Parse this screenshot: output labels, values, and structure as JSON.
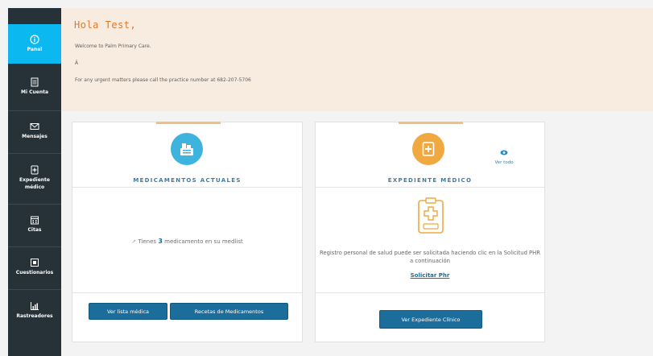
{
  "sidebar": {
    "items": [
      {
        "label": "Panel",
        "icon": "info-circle-icon"
      },
      {
        "label": "Mi Cuenta",
        "icon": "document-icon"
      },
      {
        "label": "Mensajes",
        "icon": "envelope-icon"
      },
      {
        "label": "Expediente médico",
        "icon": "medical-record-icon"
      },
      {
        "label": "Citas",
        "icon": "calendar-icon"
      },
      {
        "label": "Cuestionarios",
        "icon": "questionnaire-icon"
      },
      {
        "label": "Rastreadores",
        "icon": "chart-tracker-icon"
      }
    ],
    "active_color": "#0bb8f0",
    "bg_color": "#263238"
  },
  "banner": {
    "greeting": "Hola Test,",
    "welcome": "Welcome to Palm Primary Care.",
    "extra": "Â",
    "urgent": "For any urgent matters please call the practice number at 682-207-5706"
  },
  "medications": {
    "title": "MEDICAMENTOS ACTUALES",
    "text_prefix": "Tienes",
    "count": "3",
    "text_suffix": "medicamento en su medlist",
    "btn_list": "Ver lista médica",
    "btn_recipes": "Recetas de Medicamentos",
    "icon": "medication-icon"
  },
  "record": {
    "title": "EXPEDIENTE MÉDICO",
    "view_all": "Ver todo",
    "description": "Registro personal de salud puede ser solicitada haciendo clic en la Solicitud PHR a continuación",
    "request_link": "Solicitar Phr",
    "btn_view": "Ver Expediente Clínico",
    "icon": "medical-record-icon"
  },
  "colors": {
    "accent_blue": "#1b6d9b",
    "title_blue": "#3a7ea7",
    "orange": "#e07b2e",
    "banner_bg": "#f8ebe0"
  }
}
